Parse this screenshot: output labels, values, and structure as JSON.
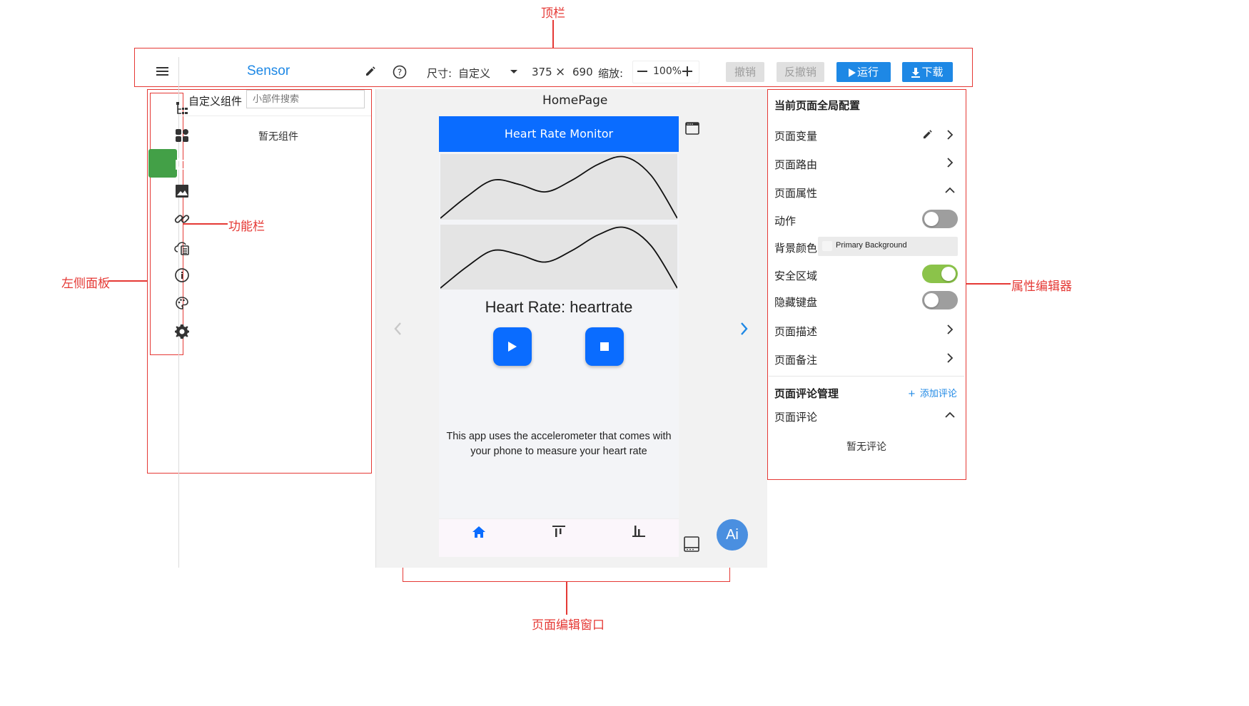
{
  "annotations": {
    "top_bar": "顶栏",
    "function_bar": "功能栏",
    "left_panel": "左侧面板",
    "property_editor": "属性编辑器",
    "page_edit_window": "页面编辑窗口"
  },
  "topbar": {
    "project_name": "Sensor",
    "size_label": "尺寸:",
    "size_preset": "自定义",
    "width": "375",
    "times": "×",
    "height": "690",
    "zoom_label": "缩放:",
    "zoom_value": "100%",
    "undo": "撤销",
    "redo": "反撤销",
    "run": "运行",
    "download": "下载"
  },
  "left_rail": {
    "icons": [
      "widget-tree-icon",
      "widgets-icon",
      "custom-component-icon",
      "image-icon",
      "link-icon",
      "data-source-icon",
      "info-icon",
      "theme-palette-icon",
      "settings-icon"
    ],
    "active_index": 2,
    "active_color": "#43a047"
  },
  "left_panel": {
    "title": "自定义组件",
    "search_placeholder": "小部件搜索",
    "empty_text": "暂无组件"
  },
  "canvas": {
    "page_name": "HomePage",
    "appbar_title": "Heart Rate Monitor",
    "appbar_color": "#0a6cff",
    "chart1": {
      "points": [
        0.0,
        0.35,
        0.62,
        0.55,
        0.43,
        0.62,
        0.88,
        1.0,
        0.7,
        0.0
      ]
    },
    "chart2": {
      "points": [
        0.0,
        0.35,
        0.62,
        0.55,
        0.43,
        0.62,
        0.88,
        1.0,
        0.7,
        0.0
      ]
    },
    "heart_rate_label": "Heart Rate:",
    "heart_rate_value": "heartrate",
    "description": "This app uses the accelerometer that comes with your phone to measure your heart rate",
    "nav_items": [
      "home-icon",
      "vertical-align-top-icon",
      "bar-chart-icon"
    ],
    "ai_button": "Ai"
  },
  "right_panel": {
    "section_title": "当前页面全局配置",
    "page_variables": "页面变量",
    "page_routes": "页面路由",
    "page_properties": "页面属性",
    "action_label": "动作",
    "action_on": false,
    "bg_color_label": "背景颜色",
    "bg_color_value": "Primary Background",
    "safe_area_label": "安全区域",
    "safe_area_on": true,
    "hide_keyboard_label": "隐藏键盘",
    "hide_keyboard_on": false,
    "page_description": "页面描述",
    "page_notes": "页面备注",
    "comments_title": "页面评论管理",
    "add_comment": "添加评论",
    "page_comments": "页面评论",
    "empty_comments": "暂无评论",
    "toggle_on_color": "#8bc34a"
  }
}
